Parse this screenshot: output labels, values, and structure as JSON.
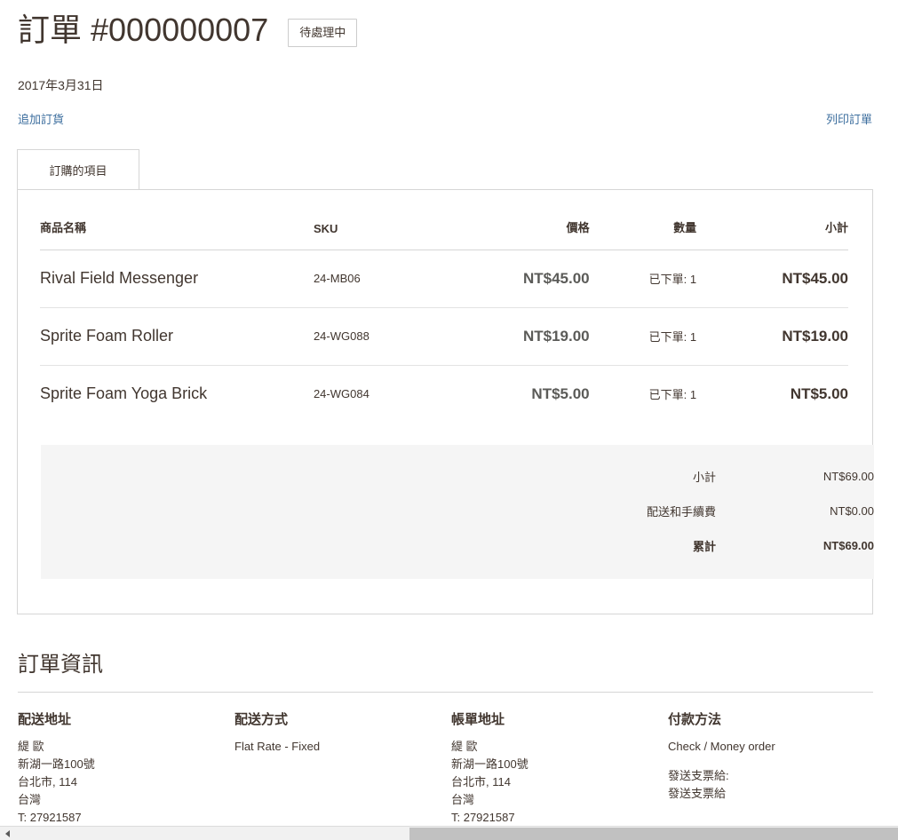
{
  "header": {
    "title": "訂單 #000000007",
    "status_badge": "待處理中",
    "order_date": "2017年3月31日"
  },
  "actions": {
    "reorder_link": "追加訂貨",
    "print_link": "列印訂單"
  },
  "tabs": [
    {
      "label": "訂購的項目",
      "active": true
    }
  ],
  "items_table": {
    "columns": {
      "name": "商品名稱",
      "sku": "SKU",
      "price": "價格",
      "qty": "數量",
      "subtotal": "小計"
    },
    "rows": [
      {
        "name": "Rival Field Messenger",
        "sku": "24-MB06",
        "price": "NT$45.00",
        "qty": "已下單: 1",
        "subtotal": "NT$45.00"
      },
      {
        "name": "Sprite Foam Roller",
        "sku": "24-WG088",
        "price": "NT$19.00",
        "qty": "已下單: 1",
        "subtotal": "NT$19.00"
      },
      {
        "name": "Sprite Foam Yoga Brick",
        "sku": "24-WG084",
        "price": "NT$5.00",
        "qty": "已下單: 1",
        "subtotal": "NT$5.00"
      }
    ]
  },
  "totals": [
    {
      "label": "小計",
      "value": "NT$69.00"
    },
    {
      "label": "配送和手續費",
      "value": "NT$0.00"
    },
    {
      "label": "累計",
      "value": "NT$69.00"
    }
  ],
  "order_information": {
    "title": "訂單資訊",
    "shipping_address": {
      "heading": "配送地址",
      "lines": [
        "緹 歐",
        "新湖一路100號",
        "台北市, 114",
        "台灣",
        "T: 27921587"
      ]
    },
    "shipping_method": {
      "heading": "配送方式",
      "lines": [
        "Flat Rate - Fixed"
      ]
    },
    "billing_address": {
      "heading": "帳單地址",
      "lines": [
        "緹 歐",
        "新湖一路100號",
        "台北市, 114",
        "台灣",
        "T: 27921587"
      ]
    },
    "payment_method": {
      "heading": "付款方法",
      "lines": [
        "Check / Money order"
      ],
      "extra_lines": [
        "發送支票給:",
        "發送支票給"
      ]
    }
  },
  "colors": {
    "link": "#3c6e9e",
    "text": "#41362f",
    "border": "#d6d6d6",
    "totals_bg": "#f5f5f5"
  }
}
